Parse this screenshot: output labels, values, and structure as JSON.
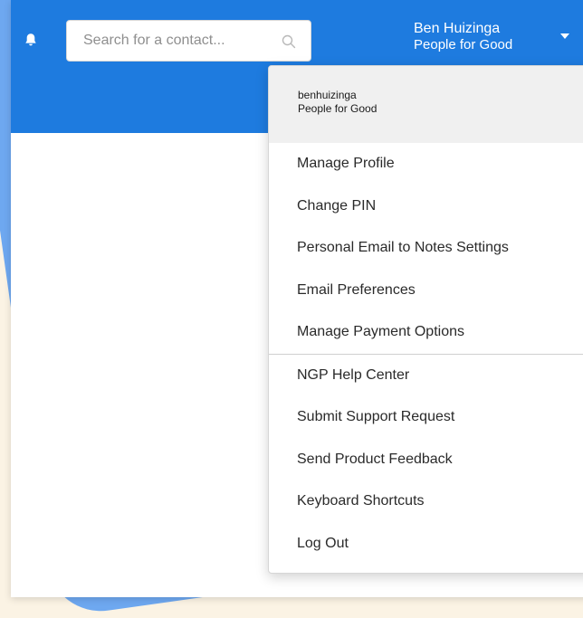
{
  "search": {
    "placeholder": "Search for a contact..."
  },
  "user": {
    "name": "Ben Huizinga",
    "organization": "People for Good"
  },
  "menu": {
    "header": {
      "username": "benhuizinga",
      "organization": "People for Good"
    },
    "group1": [
      {
        "label": "Manage Profile"
      },
      {
        "label": "Change PIN"
      },
      {
        "label": "Personal Email to Notes Settings"
      },
      {
        "label": "Email Preferences"
      },
      {
        "label": "Manage Payment Options"
      }
    ],
    "group2": [
      {
        "label": "NGP Help Center"
      },
      {
        "label": "Submit Support Request"
      },
      {
        "label": "Send Product Feedback"
      },
      {
        "label": "Keyboard Shortcuts"
      },
      {
        "label": "Log Out"
      }
    ]
  },
  "colors": {
    "topbar": "#1e7bdf",
    "background_accent": "#6ea8f0",
    "background_base": "#fbf3e4"
  },
  "icons": [
    "bell-icon",
    "search-icon",
    "chevron-down-icon"
  ]
}
